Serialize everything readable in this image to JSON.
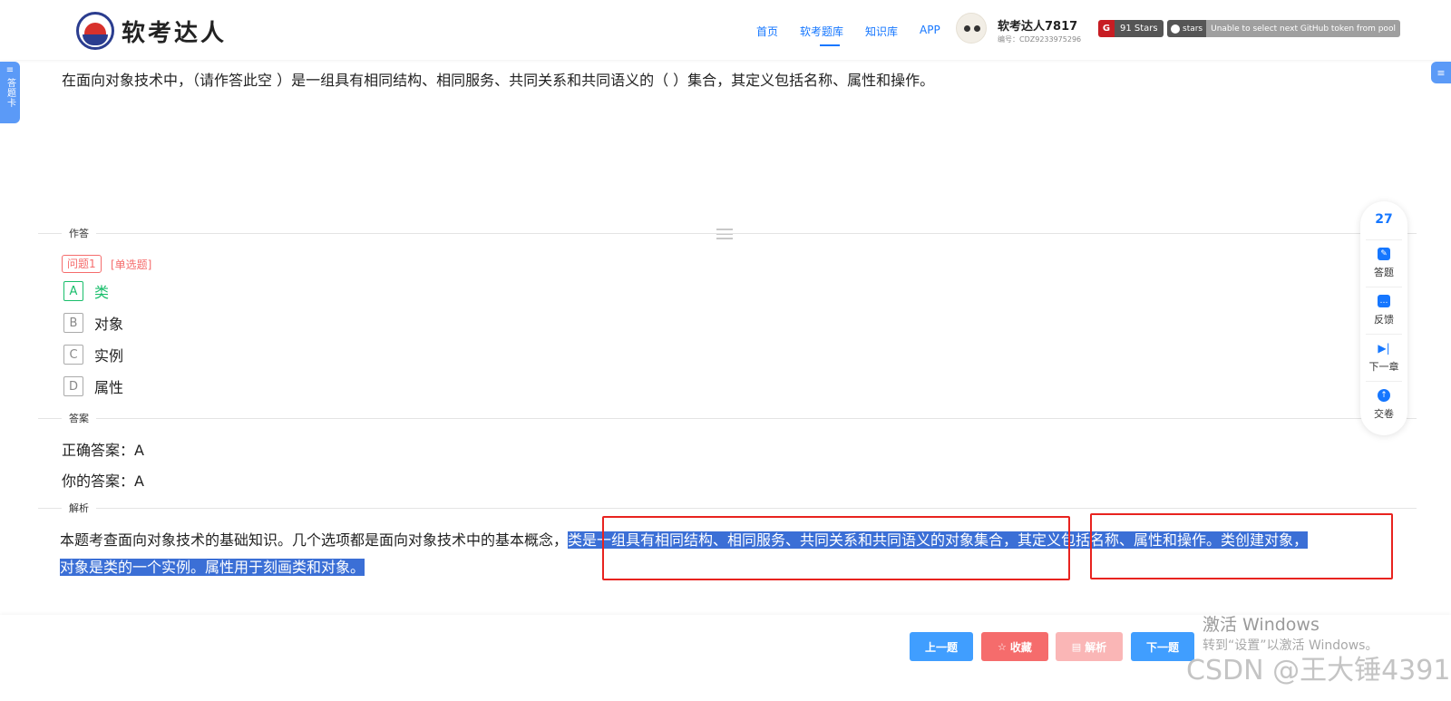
{
  "header": {
    "logo_text": "软考达人",
    "nav": [
      {
        "label": "首页",
        "active": false
      },
      {
        "label": "软考题库",
        "active": true
      },
      {
        "label": "知识库",
        "active": false
      },
      {
        "label": "APP",
        "active": false
      }
    ],
    "user_name": "软考达人7817",
    "user_id": "编号：CDZ9233975296",
    "gitee_badge": {
      "icon": "G",
      "text": "91 Stars"
    },
    "github_badge": {
      "label": "stars",
      "message": "Unable to select next GitHub token from pool"
    }
  },
  "left_tab": {
    "label": "答题卡"
  },
  "question": {
    "text": "在面向对象技术中，（请作答此空 ）是一组具有相同结构、相同服务、共同关系和共同语义的（ ）集合，其定义包括名称、属性和操作。"
  },
  "answer_section": {
    "label": "作答",
    "tag": "问题1",
    "type": "[单选题]",
    "options": [
      {
        "letter": "A",
        "text": "类",
        "correct": true
      },
      {
        "letter": "B",
        "text": "对象",
        "correct": false
      },
      {
        "letter": "C",
        "text": "实例",
        "correct": false
      },
      {
        "letter": "D",
        "text": "属性",
        "correct": false
      }
    ]
  },
  "result_section": {
    "label": "答案",
    "correct_answer": "正确答案：A",
    "your_answer": "你的答案：A"
  },
  "analysis_section": {
    "label": "解析",
    "plain": "本题考查面向对象技术的基础知识。几个选项都是面向对象技术中的基本概念，",
    "highlight_1": "类是一组具有相同结构、相同服务、共同关系和共同语义的对象集合，其定义包括名称、属性和操作。类创建对象，",
    "highlight_2": "对象是类的一个实例。属性用于刻画类和对象。"
  },
  "toolbar": {
    "count": "27",
    "items": [
      {
        "label": "答题",
        "icon": "answer-icon"
      },
      {
        "label": "反馈",
        "icon": "feedback-icon"
      },
      {
        "label": "下一章",
        "icon": "next-chapter-icon"
      },
      {
        "label": "交卷",
        "icon": "submit-icon"
      }
    ]
  },
  "footer": {
    "prev": "上一题",
    "favorite": "收藏",
    "analysis": "解析",
    "next": "下一题"
  },
  "watermarks": {
    "windows_title": "激活 Windows",
    "windows_sub": "转到“设置”以激活 Windows。",
    "csdn": "CSDN @王大锤4391"
  },
  "colors": {
    "primary": "#1677ff",
    "correct": "#19be6b",
    "danger": "#f56c6c",
    "highlight": "#3b6fd6",
    "annotation": "#e8231f"
  }
}
